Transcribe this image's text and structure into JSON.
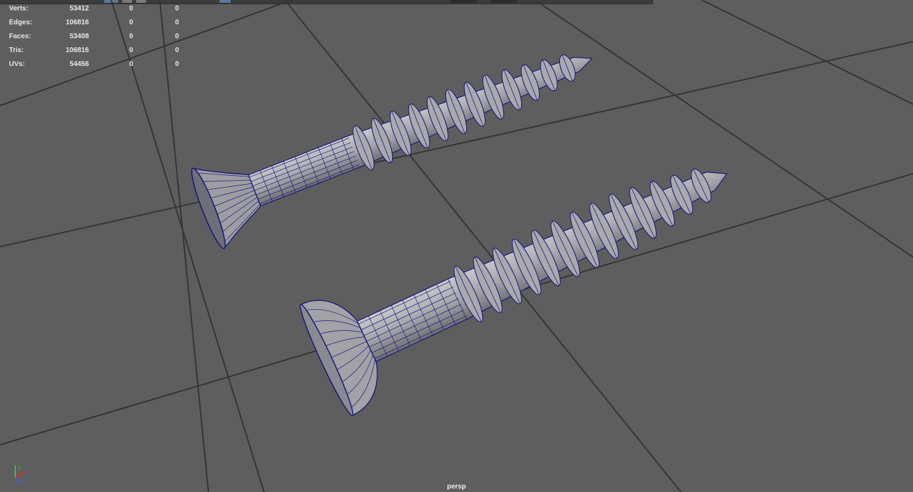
{
  "hud": {
    "rows": [
      {
        "label": "Verts:",
        "v1": "53412",
        "v2": "0",
        "v3": "0"
      },
      {
        "label": "Edges:",
        "v1": "106816",
        "v2": "0",
        "v3": "0"
      },
      {
        "label": "Faces:",
        "v1": "53408",
        "v2": "0",
        "v3": "0"
      },
      {
        "label": "Tris:",
        "v1": "106816",
        "v2": "0",
        "v3": "0"
      },
      {
        "label": "UVs:",
        "v1": "54456",
        "v2": "0",
        "v3": "0"
      }
    ]
  },
  "viewport": {
    "camera_label": "persp"
  },
  "axis_gizmo": {
    "labels": [
      "y",
      "z",
      "x"
    ]
  },
  "colors": {
    "background": "#5e5e5e",
    "grid_line": "#353535",
    "mesh_fill": "#8f8f93",
    "wire": "#1a1a78",
    "axis_x": "#d03030",
    "axis_y": "#40c040",
    "axis_z": "#4060e0"
  },
  "icons": [
    "grid-icon",
    "camera-icon",
    "wireframe-icon",
    "shaded-icon"
  ]
}
